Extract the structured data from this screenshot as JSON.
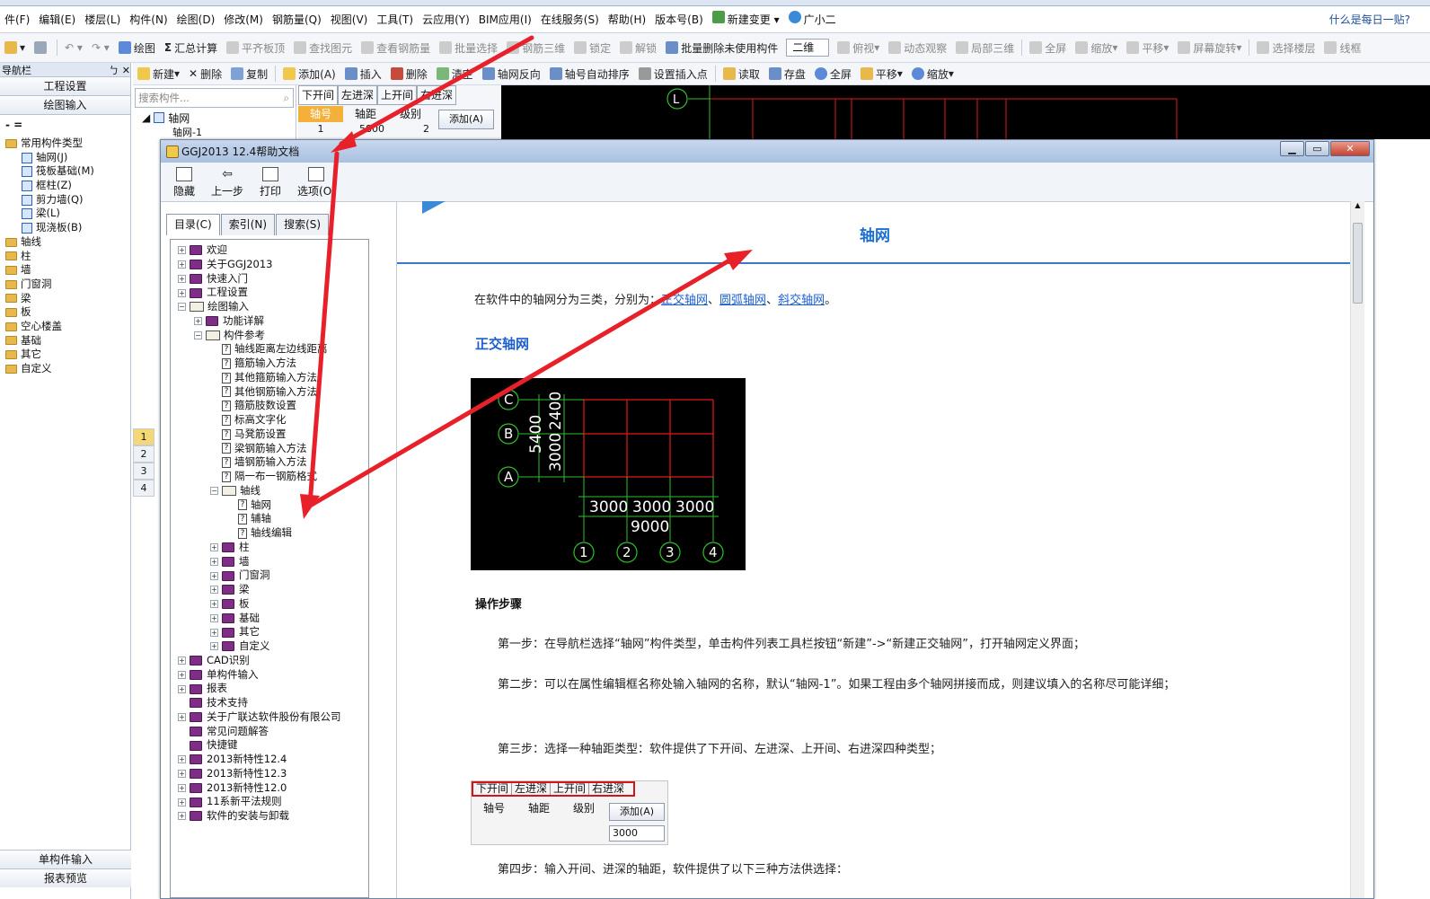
{
  "menu": [
    "件(F)",
    "编辑(E)",
    "楼层(L)",
    "构件(N)",
    "绘图(D)",
    "修改(M)",
    "钢筋量(Q)",
    "视图(V)",
    "工具(T)",
    "云应用(Y)",
    "BIM应用(I)",
    "在线服务(S)",
    "帮助(H)",
    "版本号(B)",
    "新建变更",
    "广小二"
  ],
  "menu_right": "什么是每日一贴?",
  "toolbar1": [
    "绘图",
    "汇总计算",
    "平齐板顶",
    "查找图元",
    "查看钢筋量",
    "批量选择",
    "钢筋三维",
    "锁定",
    "解锁",
    "批量删除未使用构件",
    "二维",
    "俯视",
    "动态观察",
    "局部三维",
    "全屏",
    "缩放",
    "平移",
    "屏幕旋转",
    "选择楼层",
    "线框"
  ],
  "toolbar2": [
    "新建",
    "删除",
    "复制",
    "添加(A)",
    "插入",
    "删除",
    "清空",
    "轴网反向",
    "轴号自动排序",
    "设置插入点",
    "读取",
    "存盘",
    "全屏",
    "平移",
    "缩放"
  ],
  "nav": {
    "header": "导航栏",
    "pin": "ㄅ ✕",
    "btn1": "工程设置",
    "btn2": "绘图输入",
    "dash": "- =",
    "tree": [
      {
        "label": "常用构件类型",
        "type": "folder",
        "indent": 0
      },
      {
        "label": "轴网(J)",
        "type": "item",
        "indent": 1
      },
      {
        "label": "筏板基础(M)",
        "type": "item",
        "indent": 1
      },
      {
        "label": "框柱(Z)",
        "type": "item",
        "indent": 1
      },
      {
        "label": "剪力墙(Q)",
        "type": "item",
        "indent": 1
      },
      {
        "label": "梁(L)",
        "type": "item",
        "indent": 1
      },
      {
        "label": "现浇板(B)",
        "type": "item",
        "indent": 1
      },
      {
        "label": "轴线",
        "type": "folder",
        "indent": 0
      },
      {
        "label": "柱",
        "type": "folder",
        "indent": 0
      },
      {
        "label": "墙",
        "type": "folder",
        "indent": 0
      },
      {
        "label": "门窗洞",
        "type": "folder",
        "indent": 0
      },
      {
        "label": "梁",
        "type": "folder",
        "indent": 0
      },
      {
        "label": "板",
        "type": "folder",
        "indent": 0
      },
      {
        "label": "空心楼盖",
        "type": "folder",
        "indent": 0
      },
      {
        "label": "基础",
        "type": "folder",
        "indent": 0
      },
      {
        "label": "其它",
        "type": "folder",
        "indent": 0
      },
      {
        "label": "自定义",
        "type": "folder",
        "indent": 0
      }
    ],
    "bottom1": "单构件输入",
    "bottom2": "报表预览"
  },
  "complist": {
    "search_placeholder": "搜索构件...",
    "root": "轴网",
    "child": "轴网-1",
    "rownums": [
      "1",
      "2",
      "3",
      "4"
    ]
  },
  "axis": {
    "tabs": [
      "下开间",
      "左进深",
      "上开间",
      "右进深"
    ],
    "headers": [
      "轴号",
      "轴距",
      "级别"
    ],
    "row": [
      "1",
      "5800",
      "2"
    ],
    "add": "添加(A)"
  },
  "cad": {
    "label": "L"
  },
  "help": {
    "title": "GGJ2013 12.4帮助文档",
    "tools": [
      "隐藏",
      "上一步",
      "打印",
      "选项(O)"
    ],
    "tabs": [
      "目录(C)",
      "索引(N)",
      "搜索(S)"
    ],
    "toc": [
      {
        "label": "欢迎",
        "lvl": 0,
        "exp": "+",
        "icon": "book"
      },
      {
        "label": "关于GGJ2013",
        "lvl": 0,
        "exp": "+",
        "icon": "book"
      },
      {
        "label": "快速入门",
        "lvl": 0,
        "exp": "+",
        "icon": "book"
      },
      {
        "label": "工程设置",
        "lvl": 0,
        "exp": "+",
        "icon": "book"
      },
      {
        "label": "绘图输入",
        "lvl": 0,
        "exp": "-",
        "icon": "open"
      },
      {
        "label": "功能详解",
        "lvl": 1,
        "exp": "+",
        "icon": "book"
      },
      {
        "label": "构件参考",
        "lvl": 1,
        "exp": "-",
        "icon": "open"
      },
      {
        "label": "轴线距离左边线距离",
        "lvl": 2,
        "exp": "",
        "icon": "page"
      },
      {
        "label": "箍筋输入方法",
        "lvl": 2,
        "exp": "",
        "icon": "page"
      },
      {
        "label": "其他箍筋输入方法",
        "lvl": 2,
        "exp": "",
        "icon": "page"
      },
      {
        "label": "其他钢筋输入方法",
        "lvl": 2,
        "exp": "",
        "icon": "page"
      },
      {
        "label": "箍筋肢数设置",
        "lvl": 2,
        "exp": "",
        "icon": "page"
      },
      {
        "label": "标高文字化",
        "lvl": 2,
        "exp": "",
        "icon": "page"
      },
      {
        "label": "马凳筋设置",
        "lvl": 2,
        "exp": "",
        "icon": "page"
      },
      {
        "label": "梁钢筋输入方法",
        "lvl": 2,
        "exp": "",
        "icon": "page"
      },
      {
        "label": "墙钢筋输入方法",
        "lvl": 2,
        "exp": "",
        "icon": "page"
      },
      {
        "label": "隔一布一钢筋格式",
        "lvl": 2,
        "exp": "",
        "icon": "page"
      },
      {
        "label": "轴线",
        "lvl": 2,
        "exp": "-",
        "icon": "open"
      },
      {
        "label": "轴网",
        "lvl": 3,
        "exp": "",
        "icon": "page"
      },
      {
        "label": "辅轴",
        "lvl": 3,
        "exp": "",
        "icon": "page"
      },
      {
        "label": "轴线编辑",
        "lvl": 3,
        "exp": "",
        "icon": "page"
      },
      {
        "label": "柱",
        "lvl": 2,
        "exp": "+",
        "icon": "book"
      },
      {
        "label": "墙",
        "lvl": 2,
        "exp": "+",
        "icon": "book"
      },
      {
        "label": "门窗洞",
        "lvl": 2,
        "exp": "+",
        "icon": "book"
      },
      {
        "label": "梁",
        "lvl": 2,
        "exp": "+",
        "icon": "book"
      },
      {
        "label": "板",
        "lvl": 2,
        "exp": "+",
        "icon": "book"
      },
      {
        "label": "基础",
        "lvl": 2,
        "exp": "+",
        "icon": "book"
      },
      {
        "label": "其它",
        "lvl": 2,
        "exp": "+",
        "icon": "book"
      },
      {
        "label": "自定义",
        "lvl": 2,
        "exp": "+",
        "icon": "book"
      },
      {
        "label": "CAD识别",
        "lvl": 0,
        "exp": "+",
        "icon": "book"
      },
      {
        "label": "单构件输入",
        "lvl": 0,
        "exp": "+",
        "icon": "book"
      },
      {
        "label": "报表",
        "lvl": 0,
        "exp": "+",
        "icon": "book"
      },
      {
        "label": "技术支持",
        "lvl": 0,
        "exp": "",
        "icon": "book"
      },
      {
        "label": "关于广联达软件股份有限公司",
        "lvl": 0,
        "exp": "+",
        "icon": "book"
      },
      {
        "label": "常见问题解答",
        "lvl": 0,
        "exp": "",
        "icon": "book"
      },
      {
        "label": "快捷键",
        "lvl": 0,
        "exp": "",
        "icon": "book"
      },
      {
        "label": "2013新特性12.4",
        "lvl": 0,
        "exp": "+",
        "icon": "book"
      },
      {
        "label": "2013新特性12.3",
        "lvl": 0,
        "exp": "+",
        "icon": "book"
      },
      {
        "label": "2013新特性12.0",
        "lvl": 0,
        "exp": "+",
        "icon": "book"
      },
      {
        "label": "11系新平法规则",
        "lvl": 0,
        "exp": "+",
        "icon": "book"
      },
      {
        "label": "软件的安装与卸载",
        "lvl": 0,
        "exp": "+",
        "icon": "book"
      }
    ],
    "page": {
      "title": "轴网",
      "intro_pre": "在软件中的轴网分为三类，分别为：",
      "link1": "正交轴网",
      "link2": "圆弧轴网",
      "link3": "斜交轴网",
      "sep": "、",
      "end": "。",
      "section": "正交轴网",
      "diagram": {
        "rows": [
          "C",
          "B",
          "A"
        ],
        "cols": [
          "1",
          "2",
          "3",
          "4"
        ],
        "left_dims": [
          "5400",
          "3000",
          "2400"
        ],
        "bottom_dims": [
          "3000",
          "3000",
          "3000"
        ],
        "bottom_total": "9000"
      },
      "steps_title": "操作步骤",
      "step1": "第一步：在导航栏选择“轴网”构件类型，单击构件列表工具栏按钮“新建”->“新建正交轴网”，打开轴网定义界面；",
      "step2": "第二步：可以在属性编辑框名称处输入轴网的名称，默认“轴网-1”。如果工程由多个轴网拼接而成，则建议填入的名称尽可能详细；",
      "step3": "第三步：选择一种轴距类型：软件提供了下开间、左进深、上开间、右进深四种类型；",
      "step4": "第四步：输入开间、进深的轴距，软件提供了以下三种方法供选择：",
      "mini": {
        "tabs": [
          "下开间",
          "左进深",
          "上开间",
          "右进深"
        ],
        "headers": [
          "轴号",
          "轴距",
          "级别"
        ],
        "add": "添加(A)",
        "input": "3000"
      }
    }
  },
  "colors": {
    "arrow": "#e8202a",
    "link": "#1d5fcf",
    "title": "#1d6fd0"
  }
}
